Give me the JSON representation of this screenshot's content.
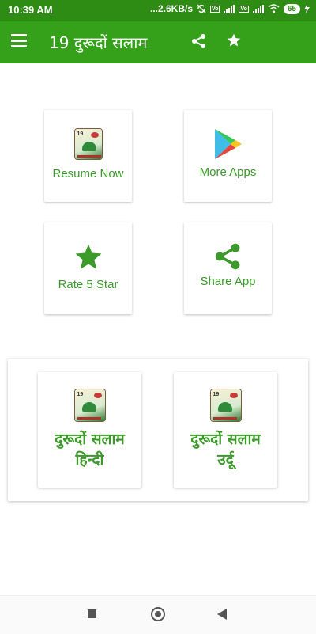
{
  "status_bar": {
    "time": "10:39 AM",
    "network_speed": "...2.6KB/s",
    "battery": "65",
    "icons": [
      "sync-off-icon",
      "signal-icon",
      "signal-icon",
      "wifi-icon",
      "battery-icon",
      "charging-icon"
    ]
  },
  "app_bar": {
    "title": "19 दुरूदों सलाम",
    "background": "#35a01a",
    "icons": [
      "menu-icon",
      "share-icon",
      "star-icon"
    ]
  },
  "cards": {
    "resume": {
      "label": "Resume Now",
      "icon": "app-logo-icon"
    },
    "more_apps": {
      "label": "More Apps",
      "icon": "play-store-icon"
    },
    "rate": {
      "label": "Rate 5 Star",
      "icon": "star-icon"
    },
    "share": {
      "label": "Share App",
      "icon": "share-icon"
    }
  },
  "languages": {
    "hindi": {
      "line1": "दुरूदों सलाम",
      "line2": "हिन्दी",
      "icon": "app-logo-hindi-icon"
    },
    "urdu": {
      "line1": "दुरूदों सलाम",
      "line2": "उर्दू",
      "icon": "app-logo-urdu-icon"
    }
  },
  "colors": {
    "accent": "#3c9a2a",
    "status_bar": "#2e8b14"
  },
  "nav_bar": {
    "icons": [
      "recents-icon",
      "home-icon",
      "back-icon"
    ]
  }
}
